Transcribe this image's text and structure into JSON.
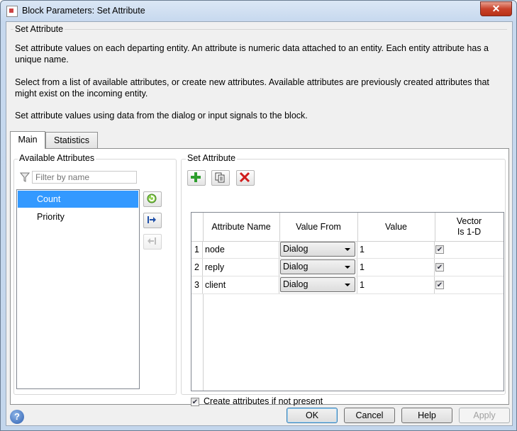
{
  "window": {
    "title": "Block Parameters: Set Attribute",
    "close_label": "✕"
  },
  "description": {
    "group_title": "Set Attribute",
    "paragraphs": [
      "Set attribute values on each departing entity. An attribute is numeric data attached to an entity. Each entity attribute has a unique name.",
      "Select from a list of available attributes, or create new attributes. Available attributes are previously created attributes that might exist on the incoming entity.",
      "Set attribute values using data from the dialog or input signals to the block."
    ]
  },
  "tabs": [
    {
      "label": "Main",
      "active": true
    },
    {
      "label": "Statistics",
      "active": false
    }
  ],
  "available": {
    "title": "Available Attributes",
    "filter_placeholder": "Filter by name",
    "items": [
      {
        "label": "Count",
        "selected": true
      },
      {
        "label": "Priority",
        "selected": false
      }
    ]
  },
  "set_attribute": {
    "title": "Set Attribute",
    "columns": [
      "Attribute Name",
      "Value From",
      "Value",
      "Vector Is 1-D"
    ],
    "column_vector_line1": "Vector",
    "column_vector_line2": "Is 1-D",
    "rows": [
      {
        "num": "1",
        "name": "node",
        "value_from": "Dialog",
        "value": "1",
        "vector": true
      },
      {
        "num": "2",
        "name": "reply",
        "value_from": "Dialog",
        "value": "1",
        "vector": true
      },
      {
        "num": "3",
        "name": "client",
        "value_from": "Dialog",
        "value": "1",
        "vector": true
      }
    ],
    "create_label": "Create attributes if not present",
    "create_checked": true
  },
  "footer": {
    "ok": "OK",
    "cancel": "Cancel",
    "help": "Help",
    "apply": "Apply"
  },
  "colors": {
    "selection": "#3399ff",
    "add": "#2e9e2e",
    "delete": "#d01c1c"
  }
}
